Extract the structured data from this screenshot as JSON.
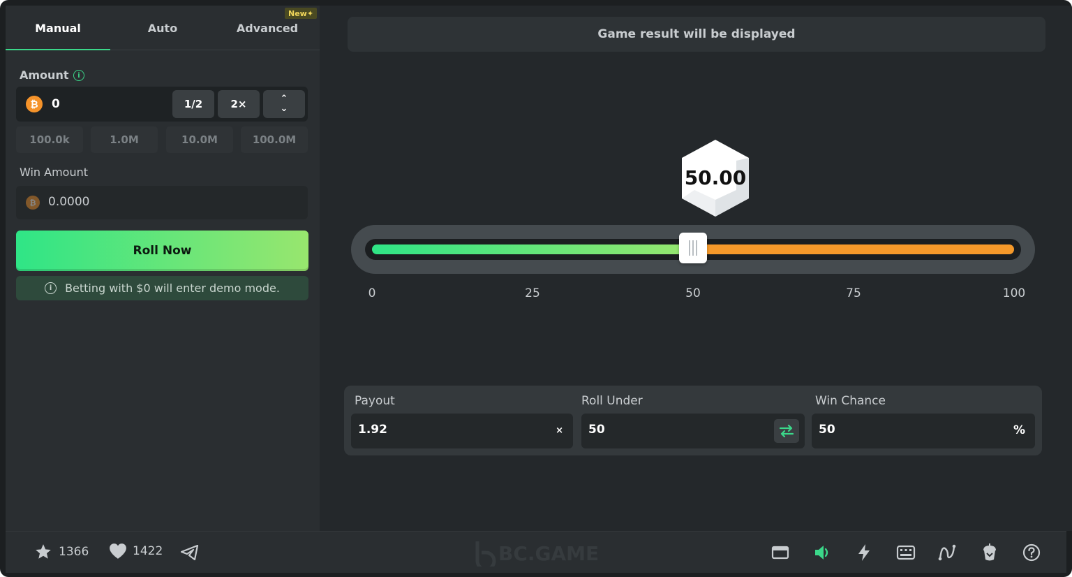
{
  "tabs": [
    {
      "label": "Manual"
    },
    {
      "label": "Auto"
    },
    {
      "label": "Advanced"
    }
  ],
  "new_badge": "New✦",
  "amount": {
    "label": "Amount",
    "value": "0",
    "half_label": "1/2",
    "double_label": "2×",
    "quick_values": [
      "100.0k",
      "1.0M",
      "10.0M",
      "100.0M"
    ]
  },
  "win_amount": {
    "label": "Win Amount",
    "value": "0.0000"
  },
  "roll_button": "Roll Now",
  "demo_note": "Betting with $0 will enter demo mode.",
  "result_banner": "Game result will be displayed",
  "dice_value": "50.00",
  "slider": {
    "value": 50,
    "min": 0,
    "max": 100,
    "ticks": [
      "0",
      "25",
      "50",
      "75",
      "100"
    ],
    "colors": {
      "win": "#3bd88a",
      "lose": "#f5992a"
    }
  },
  "stats": {
    "payout": {
      "label": "Payout",
      "value": "1.92",
      "suffix": "×"
    },
    "roll_under": {
      "label": "Roll Under",
      "value": "50"
    },
    "win_chance": {
      "label": "Win Chance",
      "value": "50",
      "suffix": "%"
    }
  },
  "footer": {
    "favorites_count": "1366",
    "likes_count": "1422",
    "logo_text": "BC.GAME",
    "icons": [
      "window-icon",
      "volume-icon",
      "lightning-icon",
      "keyboard-icon",
      "chart-icon",
      "fairness-icon",
      "help-icon"
    ]
  },
  "colors": {
    "accent": "#3bd88a",
    "orange": "#f5992a",
    "bg": "#24282b"
  }
}
